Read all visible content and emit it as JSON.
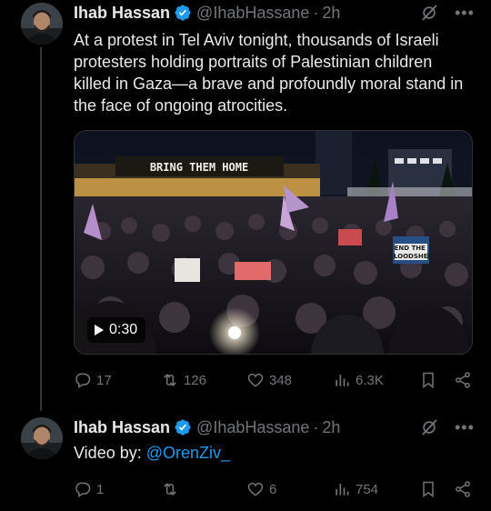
{
  "tweets": [
    {
      "author_name": "Ihab Hassan",
      "handle": "@IhabHassane",
      "separator": "·",
      "time": "2h",
      "text": "At a protest in Tel Aviv tonight, thousands of Israeli protesters holding portraits of Palestinian children killed in Gaza—a brave and profoundly moral stand in the face of ongoing atrocities.",
      "video": {
        "duration": "0:30",
        "banner_text": "BRING THEM HOME",
        "sign_text": "END THE BLOODSHED"
      },
      "stats": {
        "replies": "17",
        "reposts": "126",
        "likes": "348",
        "views": "6.3K"
      }
    },
    {
      "author_name": "Ihab Hassan",
      "handle": "@IhabHassane",
      "separator": "·",
      "time": "2h",
      "text_prefix": "Video by: ",
      "mention": "@OrenZiv_",
      "stats": {
        "replies": "1",
        "reposts": "",
        "likes": "6",
        "views": "754"
      }
    }
  ],
  "colors": {
    "background": "#000000",
    "text": "#e7e9ea",
    "muted": "#71767b",
    "link": "#1d9bf0",
    "verified": "#1d9bf0"
  },
  "icons": [
    "verified-badge-icon",
    "grok-icon",
    "more-icon",
    "reply-icon",
    "repost-icon",
    "like-icon",
    "views-icon",
    "bookmark-icon",
    "share-icon",
    "play-icon"
  ]
}
